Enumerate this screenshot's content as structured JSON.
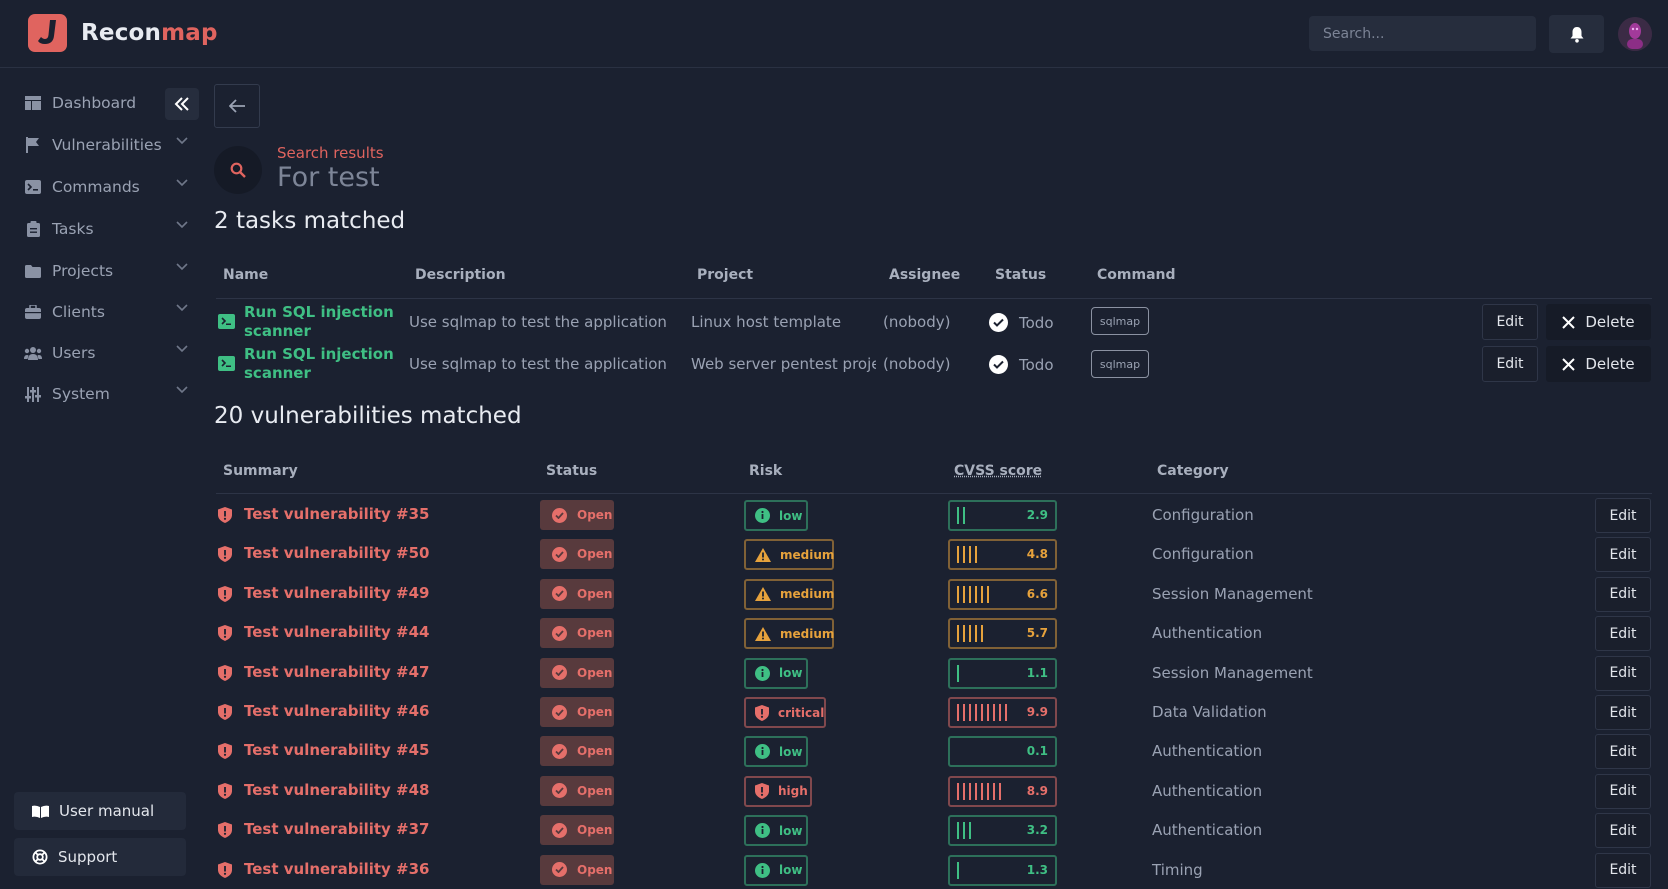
{
  "header": {
    "brand_prefix": "Recon",
    "brand_suffix": "map",
    "search_placeholder": "Search...",
    "colors": {
      "accent": "#e0645f",
      "background": "#1b2130"
    }
  },
  "sidebar": {
    "items": [
      {
        "label": "Dashboard",
        "icon": "dashboard-icon",
        "expandable": false
      },
      {
        "label": "Vulnerabilities",
        "icon": "flag-icon",
        "expandable": true
      },
      {
        "label": "Commands",
        "icon": "terminal-icon",
        "expandable": true
      },
      {
        "label": "Tasks",
        "icon": "clipboard-icon",
        "expandable": true
      },
      {
        "label": "Projects",
        "icon": "folder-icon",
        "expandable": true
      },
      {
        "label": "Clients",
        "icon": "briefcase-icon",
        "expandable": true
      },
      {
        "label": "Users",
        "icon": "users-icon",
        "expandable": true
      },
      {
        "label": "System",
        "icon": "sliders-icon",
        "expandable": true
      }
    ],
    "user_manual": "User manual",
    "support": "Support"
  },
  "page": {
    "kicker": "Search results",
    "search_term": "For test"
  },
  "tasks": {
    "title": "2 tasks matched",
    "columns": [
      "Name",
      "Description",
      "Project",
      "Assignee",
      "Status",
      "Command"
    ],
    "rows": [
      {
        "name_line1": "Run SQL injection",
        "name_line2": "scanner",
        "description": "Use sqlmap to test the application for S",
        "project": "Linux host template",
        "assignee": "(nobody)",
        "status": "Todo",
        "command": "sqlmap",
        "edit": "Edit",
        "delete": "Delete"
      },
      {
        "name_line1": "Run SQL injection",
        "name_line2": "scanner",
        "description": "Use sqlmap to test the application for S",
        "project": "Web server pentest project",
        "assignee": "(nobody)",
        "status": "Todo",
        "command": "sqlmap",
        "edit": "Edit",
        "delete": "Delete"
      }
    ]
  },
  "vulnerabilities": {
    "title": "20 vulnerabilities matched",
    "columns": [
      "Summary",
      "Status",
      "Risk",
      "CVSS score",
      "Category"
    ],
    "risk_colors": {
      "low": "#3fbf84",
      "medium": "#e6a23c",
      "high": "#e56f6a",
      "critical": "#e56f6a"
    },
    "rows": [
      {
        "summary": "Test vulnerability #35",
        "status": "Open",
        "risk": "low",
        "cvss": "2.9",
        "category": "Configuration",
        "edit": "Edit"
      },
      {
        "summary": "Test vulnerability #50",
        "status": "Open",
        "risk": "medium",
        "cvss": "4.8",
        "category": "Configuration",
        "edit": "Edit"
      },
      {
        "summary": "Test vulnerability #49",
        "status": "Open",
        "risk": "medium",
        "cvss": "6.6",
        "category": "Session Management",
        "edit": "Edit"
      },
      {
        "summary": "Test vulnerability #44",
        "status": "Open",
        "risk": "medium",
        "cvss": "5.7",
        "category": "Authentication",
        "edit": "Edit"
      },
      {
        "summary": "Test vulnerability #47",
        "status": "Open",
        "risk": "low",
        "cvss": "1.1",
        "category": "Session Management",
        "edit": "Edit"
      },
      {
        "summary": "Test vulnerability #46",
        "status": "Open",
        "risk": "critical",
        "cvss": "9.9",
        "category": "Data Validation",
        "edit": "Edit"
      },
      {
        "summary": "Test vulnerability #45",
        "status": "Open",
        "risk": "low",
        "cvss": "0.1",
        "category": "Authentication",
        "edit": "Edit"
      },
      {
        "summary": "Test vulnerability #48",
        "status": "Open",
        "risk": "high",
        "cvss": "8.9",
        "category": "Authentication",
        "edit": "Edit"
      },
      {
        "summary": "Test vulnerability #37",
        "status": "Open",
        "risk": "low",
        "cvss": "3.2",
        "category": "Authentication",
        "edit": "Edit"
      },
      {
        "summary": "Test vulnerability #36",
        "status": "Open",
        "risk": "low",
        "cvss": "1.3",
        "category": "Timing",
        "edit": "Edit"
      }
    ]
  }
}
